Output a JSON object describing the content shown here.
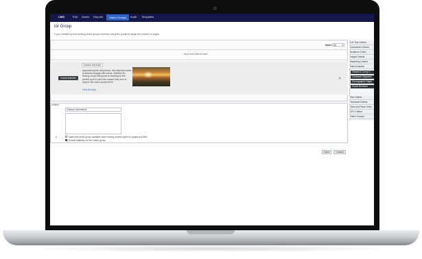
{
  "app": {
    "brand": "CMS",
    "nav": [
      "Edit",
      "Admin",
      "Reports",
      "Visitor Groups",
      "Audit",
      "Templates"
    ],
    "active_nav": "Visitor Groups"
  },
  "page": {
    "title": "tor Group",
    "subtitle": "e your website by first creating visitor groups and then using the groups to target the content on pages."
  },
  "match": {
    "label": "Match",
    "value": "All"
  },
  "criteria": {
    "drop_hint": "Drop new criterion here",
    "item_button": "Social Advertis",
    "item_tag": "Outdoor Adventur",
    "desc_lines": [
      "Approaching the wild places, this elephant wants",
      "to actively engage with nature. Whether it's",
      "finding a cozy hiking trail or heading for the",
      "perfect spot to catch the sunset, they love to",
      "explore the world around them."
    ],
    "link": "View the Map",
    "remove_icon": "cross-icon"
  },
  "sidebar": {
    "items_top": [
      "& B Test Criteria",
      "Commerce Criteria",
      "Audience Criteri",
      "Insight Criteria",
      "Marketing Criteria",
      "Data Analytics"
    ],
    "dark_items": [
      "Viewed & Comp C",
      "Customer Segment",
      "Demographic Segm",
      "Social Behavior"
    ],
    "items_bottom": [
      "Site Criteria",
      "Technical Criteria",
      "Time and Place Criter",
      "URL Criteria",
      "Visitor Groups"
    ]
  },
  "form": {
    "section_label": "rmation",
    "name_value": "Outdoor Adventurer",
    "notes_placeholder": "",
    "row_label": "s",
    "checkbox_1": "Make this visitor group available when setting access rights for pages and files",
    "checkbox_2": "Enable statistics for this visitor group",
    "checkbox_1_checked": false,
    "checkbox_2_checked": true
  },
  "actions": {
    "save": "Save",
    "cancel": "Cancel"
  }
}
